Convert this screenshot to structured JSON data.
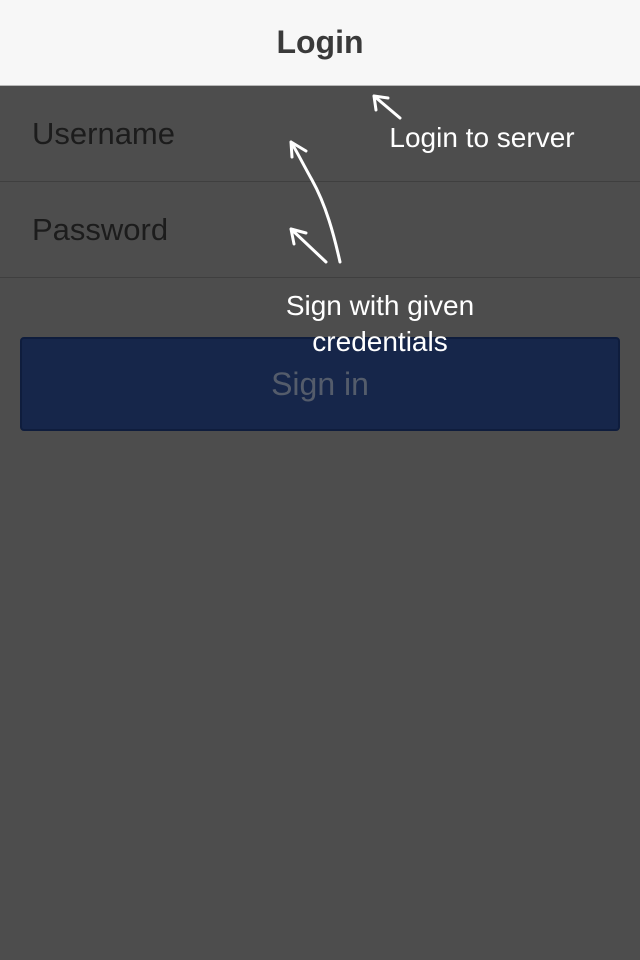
{
  "header": {
    "title": "Login"
  },
  "form": {
    "username_placeholder": "Username",
    "username_value": "",
    "password_placeholder": "Password",
    "password_value": "",
    "signin_label": "Sign in"
  },
  "annotations": {
    "login_note": "Login to server",
    "sign_note": "Sign with given credentials"
  },
  "colors": {
    "navbar_bg": "#f7f7f7",
    "page_bg": "#4d4d4d",
    "button_bg": "#16264a",
    "annotation_text": "#ffffff"
  }
}
